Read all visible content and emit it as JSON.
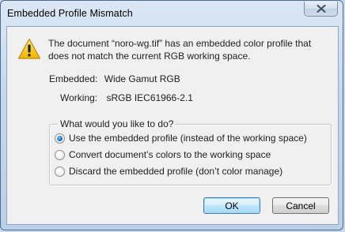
{
  "dialog": {
    "title": "Embedded Profile Mismatch",
    "close_icon": "close-icon",
    "warning_icon": "warning-icon",
    "message_line1": "The document “noro-wg.tif” has an embedded color profile that",
    "message_line2": "does not match the current RGB working space.",
    "embedded_label": "Embedded:",
    "embedded_value": "Wide Gamut RGB",
    "working_label": "Working:",
    "working_value": "sRGB IEC61966-2.1",
    "group_title": "What would you like to do?",
    "options": [
      {
        "label": "Use the embedded profile (instead of the working space)",
        "checked": true
      },
      {
        "label": "Convert document’s colors to the working space",
        "checked": false
      },
      {
        "label": "Discard the embedded profile (don’t color manage)",
        "checked": false
      }
    ],
    "ok_label": "OK",
    "cancel_label": "Cancel"
  },
  "colors": {
    "frame": "#c8d7ea",
    "client_bg": "#f0f0f0",
    "warning_yellow": "#f5c518",
    "radio_selected": "#1f6fb8"
  }
}
